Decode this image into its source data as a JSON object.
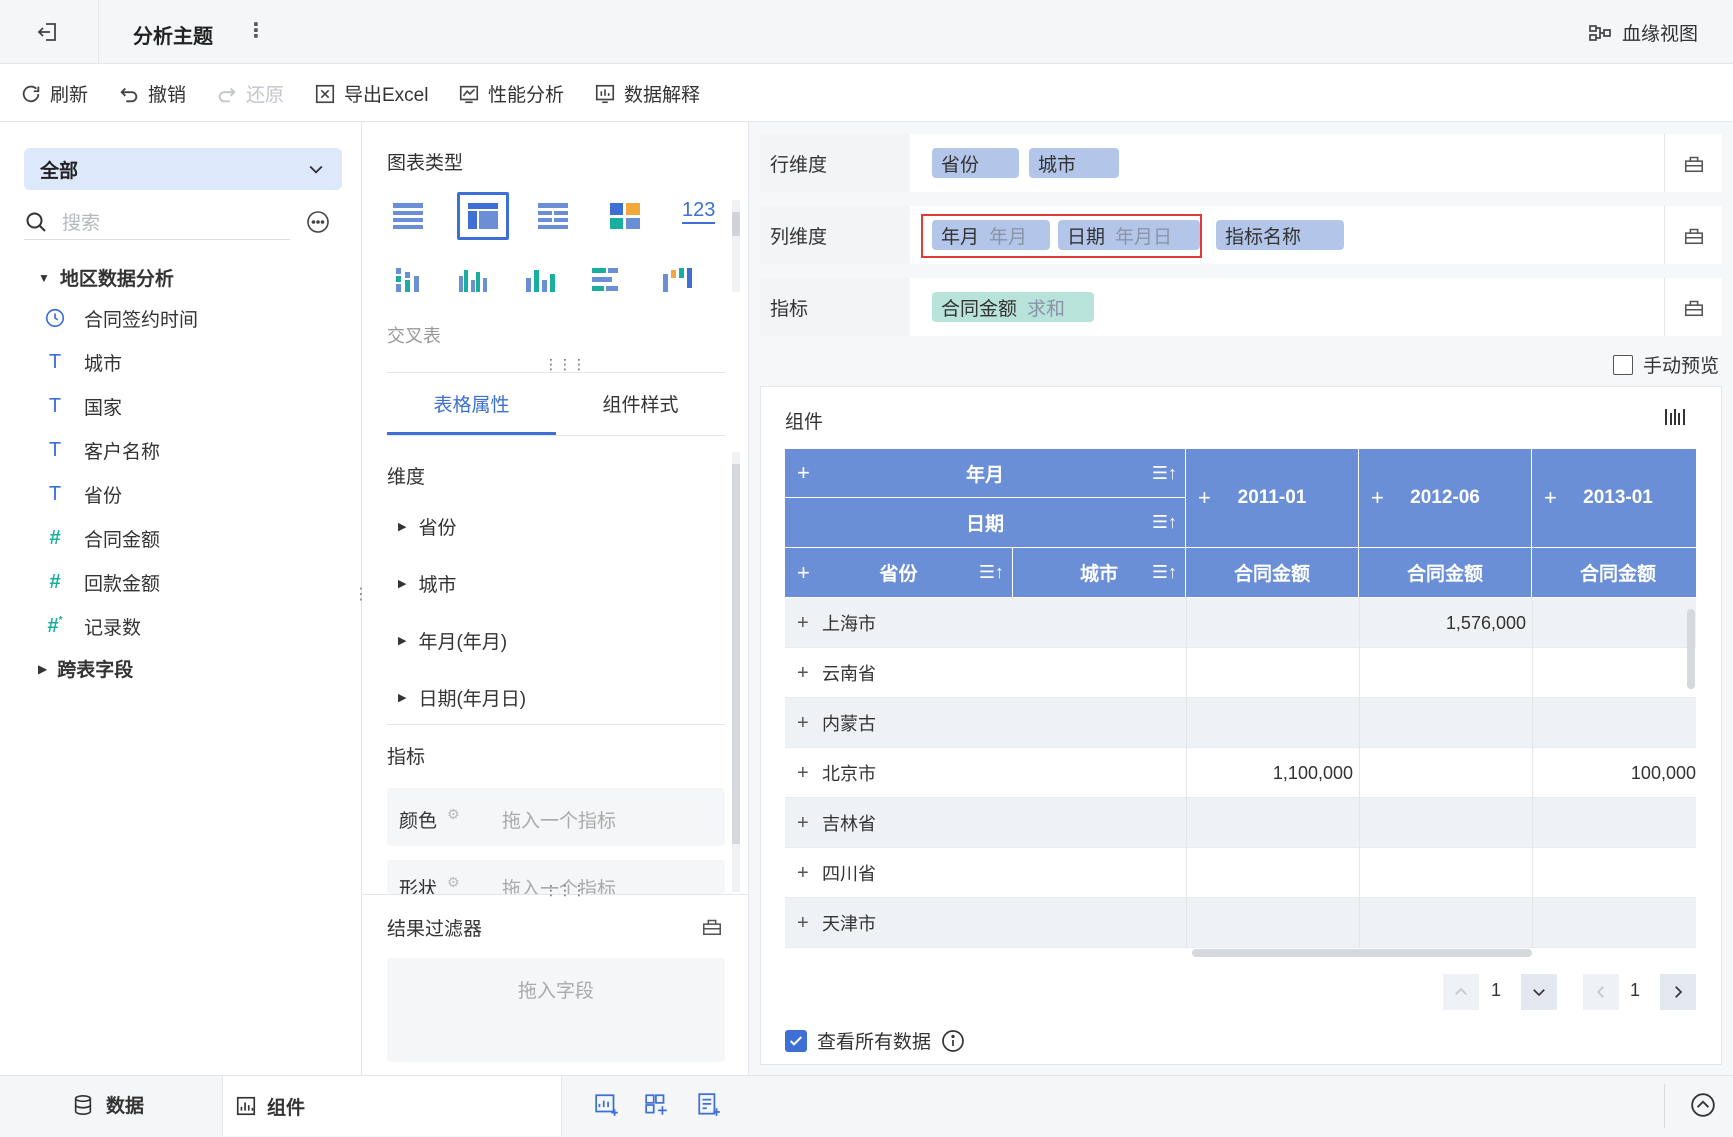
{
  "topbar": {
    "title": "分析主题",
    "lineage_label": "血缘视图"
  },
  "toolbar": {
    "refresh": "刷新",
    "undo": "撤销",
    "redo": "还原",
    "export": "导出Excel",
    "perf": "性能分析",
    "explain": "数据解释"
  },
  "left": {
    "scope_select": "全部",
    "search_placeholder": "搜索",
    "group1": "地区数据分析",
    "fields": [
      {
        "label": "合同签约时间",
        "icon": "clock-icon"
      },
      {
        "label": "城市",
        "icon": "text-type-icon"
      },
      {
        "label": "国家",
        "icon": "text-type-icon"
      },
      {
        "label": "客户名称",
        "icon": "text-type-icon"
      },
      {
        "label": "省份",
        "icon": "text-type-icon"
      },
      {
        "label": "合同金额",
        "icon": "number-type-icon"
      },
      {
        "label": "回款金额",
        "icon": "number-type-icon"
      },
      {
        "label": "记录数",
        "icon": "computed-number-icon"
      }
    ],
    "group2": "跨表字段"
  },
  "middle": {
    "chart_type_title": "图表类型",
    "chart_type_selected": "交叉表",
    "tabs": [
      "表格属性",
      "组件样式"
    ],
    "dim_title": "维度",
    "dims": [
      "省份",
      "城市",
      "年月(年月)",
      "日期(年月日)"
    ],
    "metric_title": "指标",
    "color_label": "颜色",
    "color_placeholder": "拖入一个指标",
    "shape_label": "形状",
    "shape_placeholder": "拖入一个指标",
    "filter_title": "结果过滤器",
    "filter_placeholder": "拖入字段"
  },
  "right": {
    "row_dim_label": "行维度",
    "row_chips": [
      "省份",
      "城市"
    ],
    "col_dim_label": "列维度",
    "col_chips": [
      {
        "name": "年月",
        "sub": "年月"
      },
      {
        "name": "日期",
        "sub": "年月日"
      },
      {
        "name": "指标名称",
        "sub": ""
      }
    ],
    "metric_label": "指标",
    "metric_chip": {
      "name": "合同金额",
      "sub": "求和"
    },
    "manual_preview": "手动预览",
    "component_title": "组件",
    "table": {
      "col_header_yearmonth": "年月",
      "col_header_date": "日期",
      "row_header_province": "省份",
      "row_header_city": "城市",
      "periods": [
        "2011-01",
        "2012-06",
        "2013-01"
      ],
      "metric_header": "合同金额",
      "rows": [
        {
          "name": "上海市",
          "v1": "",
          "v2": "1,576,000",
          "v3": ""
        },
        {
          "name": "云南省",
          "v1": "",
          "v2": "",
          "v3": ""
        },
        {
          "name": "内蒙古",
          "v1": "",
          "v2": "",
          "v3": ""
        },
        {
          "name": "北京市",
          "v1": "1,100,000",
          "v2": "",
          "v3": "100,000"
        },
        {
          "name": "吉林省",
          "v1": "",
          "v2": "",
          "v3": ""
        },
        {
          "name": "四川省",
          "v1": "",
          "v2": "",
          "v3": ""
        },
        {
          "name": "天津市",
          "v1": "",
          "v2": "",
          "v3": ""
        }
      ]
    },
    "pager_v": "1",
    "pager_h": "1",
    "view_all": "查看所有数据"
  },
  "bottom": {
    "tab_data": "数据",
    "tab_component": "组件"
  },
  "colors": {
    "accent": "#3d6fd4",
    "header_blue": "#6b8fd6",
    "chip_blue": "#b3c6ea",
    "chip_green": "#b8e3db",
    "highlight_red": "#e03a3a"
  }
}
